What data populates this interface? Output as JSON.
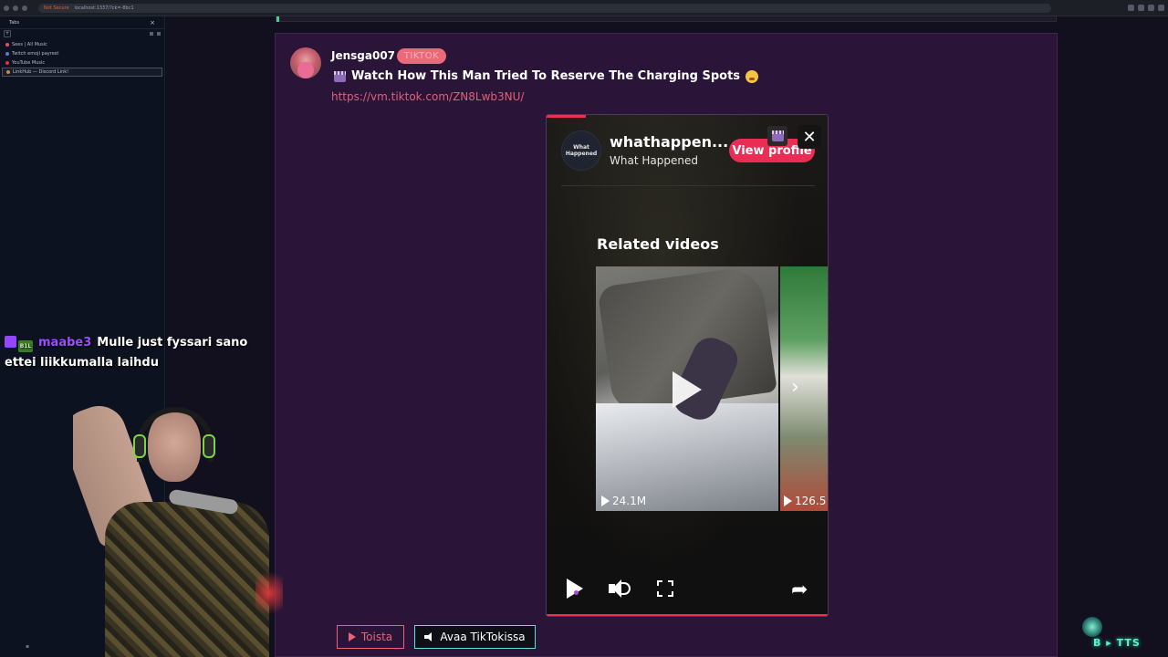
{
  "browser": {
    "tab_title": "Not Secure",
    "url": "localhost:1337/?ck=-8bc1"
  },
  "sidebar": {
    "header": "Tabs",
    "close_glyph": "×",
    "new_tab_glyph": "+",
    "tabs": [
      {
        "label": "Sees | All Music",
        "color": "#e0506a"
      },
      {
        "label": "Twitch emoji payrest",
        "color": "#5b7bd6"
      },
      {
        "label": "YouTube Music",
        "color": "#e0304a"
      },
      {
        "label": "LinkHub — Discord Link!",
        "color": "#d08a30",
        "active": true
      }
    ]
  },
  "post": {
    "username": "Jensga007",
    "platform_badge": "TIKTOK",
    "title": "Watch How This Man Tried To Reserve The Charging Spots",
    "link": "https://vm.tiktok.com/ZN8Lwb3NU/"
  },
  "embed": {
    "logo_text": "What Happened",
    "account_handle": "whathappen...",
    "account_name": "What Happened",
    "view_profile_label": "View profile",
    "close_glyph": "✕",
    "progress": 0.14,
    "related_title": "Related videos",
    "related": [
      {
        "views": "24.1M"
      },
      {
        "views": "126.5"
      }
    ],
    "next_glyph": "›",
    "share_glyph": "➦"
  },
  "actions": {
    "play_label": "Toista",
    "open_label": "Avaa TikTokissa"
  },
  "chat": {
    "sub_badge": "B1L",
    "user": "maabe3",
    "message": "Mulle just fyssari sano ettei liikkumalla laihdu",
    "user_color": "#9b4dff"
  },
  "tts": {
    "label": "B ▸ TTS"
  },
  "colors": {
    "accent_pink": "#ea2d54",
    "card_bg": "#2a1538",
    "link": "#e0607a"
  }
}
